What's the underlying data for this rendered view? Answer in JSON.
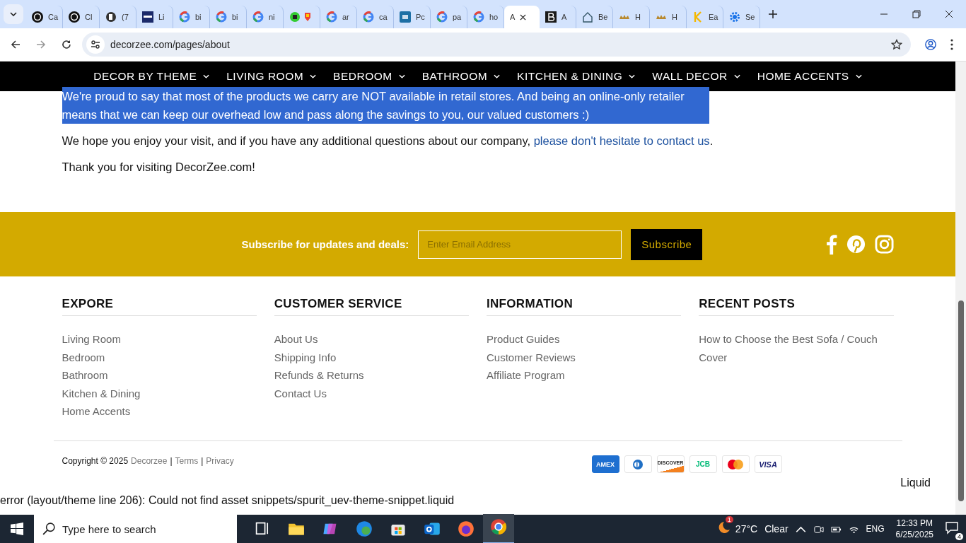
{
  "browser": {
    "tabs": [
      {
        "title": "Ca",
        "kind": "ai",
        "selected": false
      },
      {
        "title": "Cl",
        "kind": "ai",
        "selected": false
      },
      {
        "title": "(7",
        "kind": "bq",
        "selected": false
      },
      {
        "title": "Li",
        "kind": "ttp",
        "selected": false
      },
      {
        "title": "bi",
        "kind": "g",
        "selected": false
      },
      {
        "title": "bi",
        "kind": "g",
        "selected": false
      },
      {
        "title": "ni",
        "kind": "g",
        "selected": false
      },
      {
        "kind": "green",
        "selected": false
      },
      {
        "title": "ar",
        "kind": "g",
        "selected": false
      },
      {
        "title": "ca",
        "kind": "g",
        "selected": false
      },
      {
        "title": "Pc",
        "kind": "xf",
        "selected": false
      },
      {
        "title": "pa",
        "kind": "g",
        "selected": false
      },
      {
        "title": "ho",
        "kind": "g",
        "selected": false
      },
      {
        "title": "A",
        "kind": "none",
        "selected": true
      },
      {
        "title": "A",
        "kind": "b",
        "selected": false
      },
      {
        "title": "Be",
        "kind": "house",
        "selected": false
      },
      {
        "title": "H",
        "kind": "crown",
        "selected": false
      },
      {
        "title": "H",
        "kind": "crown",
        "selected": false
      },
      {
        "title": "Ea",
        "kind": "k",
        "selected": false
      },
      {
        "title": "Se",
        "kind": "gear",
        "selected": false
      }
    ],
    "address": "decorzee.com/pages/about"
  },
  "nav": [
    "DECOR BY THEME",
    "LIVING ROOM",
    "BEDROOM",
    "BATHROOM",
    "KITCHEN & DINING",
    "WALL DECOR",
    "HOME ACCENTS"
  ],
  "content": {
    "paragraphs": [
      {
        "text": "We're proud to say that most of the products we carry are NOT available in retail stores. And being an online-only retailer means that we can keep our overhead low and pass along the savings to you, our valued customers :)",
        "selected": true
      },
      {
        "text": "We hope you enjoy your visit, and if you have any additional questions about our company, ",
        "link": "please don't hesitate to contact us",
        "after": ".",
        "selected": false
      },
      {
        "text": "Thank you for visiting DecorZee.com!",
        "selected": false
      }
    ]
  },
  "subscribe": {
    "label": "Subscribe for updates and deals:",
    "placeholder": "Enter Email Address",
    "button": "Subscribe"
  },
  "footer_columns": [
    {
      "heading": "EXPORE",
      "links": [
        "Living Room",
        "Bedroom",
        "Bathroom",
        "Kitchen & Dining",
        "Home Accents"
      ]
    },
    {
      "heading": "CUSTOMER SERVICE",
      "links": [
        "About Us",
        "Shipping Info",
        "Refunds & Returns",
        "Contact Us"
      ]
    },
    {
      "heading": "INFORMATION",
      "links": [
        "Product Guides",
        "Customer Reviews",
        "Affiliate Program"
      ]
    },
    {
      "heading": "RECENT POSTS",
      "links": [
        "How to Choose the Best Sofa / Couch Cover"
      ]
    }
  ],
  "copyright": {
    "text": "Copyright © 2025",
    "links": [
      "Decorzee",
      "Terms",
      "Privacy"
    ],
    "separator": "|"
  },
  "payment_methods": [
    {
      "kind": "amex",
      "label": "AMEX"
    },
    {
      "kind": "diners"
    },
    {
      "kind": "discover",
      "label": "DISCOVER"
    },
    {
      "kind": "jcb",
      "label": "JCB"
    },
    {
      "kind": "mastercard"
    },
    {
      "kind": "visa",
      "label": "VISA"
    }
  ],
  "liquid_label": "Liquid",
  "error": "error (layout/theme line 206): Could not find asset snippets/spurit_uev-theme-snippet.liquid",
  "taskbar": {
    "search_placeholder": "Type here to search",
    "weather_badge": "1",
    "temperature": "27°C",
    "condition": "Clear",
    "language": "ENG",
    "time": "12:33 PM",
    "date": "6/25/2025",
    "notifications": "4"
  }
}
